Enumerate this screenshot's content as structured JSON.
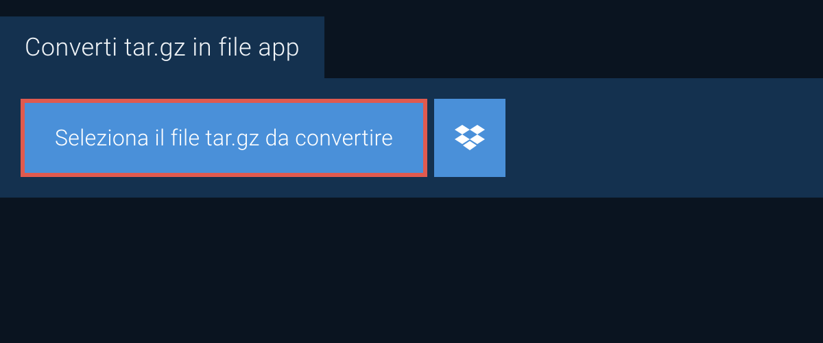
{
  "header": {
    "title": "Converti tar.gz in file app"
  },
  "main": {
    "select_button_label": "Seleziona il file tar.gz da convertire"
  },
  "colors": {
    "background": "#0a1420",
    "panel": "#14314f",
    "button": "#4a90d9",
    "highlight_border": "#e05a4f"
  }
}
